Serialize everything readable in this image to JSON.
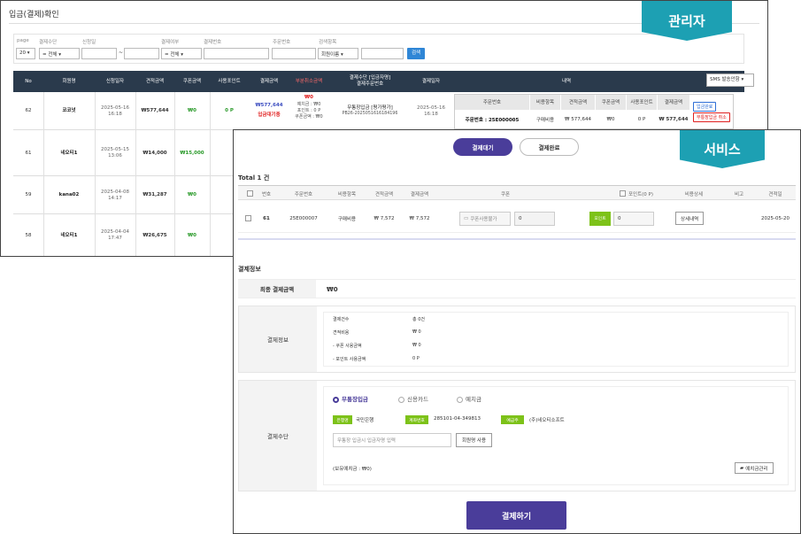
{
  "admin": {
    "title": "입금(결제)확인",
    "filters": [
      {
        "label": "page",
        "value": "20 ▾"
      },
      {
        "label": "결제수단",
        "value": "= 전체 ▾"
      },
      {
        "label": "신청일",
        "value": ""
      },
      {
        "label": "",
        "value": "~"
      },
      {
        "label": "",
        "value": ""
      },
      {
        "label": "결제여부",
        "value": "= 전체 ▾"
      },
      {
        "label": "결제번호",
        "value": ""
      },
      {
        "label": "주문번호",
        "value": ""
      },
      {
        "label": "검색항목",
        "value": "회원이름 ▾"
      },
      {
        "label": "",
        "value": ""
      }
    ],
    "search_label": "검색",
    "columns": [
      "No",
      "회원명",
      "신청일자",
      "견적금액",
      "쿠폰금액",
      "사용포인트",
      "결제금액",
      "부분취소금액",
      "결제수단 [입금자명]\n결제주문번호",
      "결제일자",
      "내역"
    ],
    "sms_label": "SMS 발송안함 ▾",
    "rows": [
      {
        "no": "62",
        "name": "코코넛",
        "date": "2025-05-16\n16:18",
        "quote": "₩577,644",
        "coupon": "₩0",
        "point": "0 P",
        "pay": "₩577,644",
        "pay_status": "입금대기중",
        "cancel": "₩0",
        "cancel_detail": "예치금 : ₩0\n포인트 : 0 P\n쿠폰금액 : ₩0",
        "method": "무통장입금 [평가평가]",
        "order": "PB26-2025051616184196",
        "paydate": "2025-05-16\n16:18"
      },
      {
        "no": "61",
        "name": "네오티1",
        "date": "2025-05-15\n13:06",
        "quote": "₩14,000",
        "coupon": "₩15,000"
      },
      {
        "no": "59",
        "name": "kana02",
        "date": "2025-04-08\n14:17",
        "quote": "₩31,287",
        "coupon": "₩0"
      },
      {
        "no": "58",
        "name": "네오티1",
        "date": "2025-04-04\n17:47",
        "quote": "₩26,675",
        "coupon": "₩0"
      }
    ],
    "sub": {
      "headers": [
        "주문번호",
        "비용항목",
        "견적금액",
        "쿠폰금액",
        "사용포인트",
        "결제금액"
      ],
      "order": "주문번호 : 25E000005",
      "item": "구매비용",
      "quote": "₩ 577,644",
      "coupon": "₩0",
      "point": "0 P",
      "pay": "₩ 577,644"
    },
    "badge_confirm": "입금완료",
    "badge_cancel": "무통장입금 취소",
    "tag": "관리자"
  },
  "service": {
    "tag": "서비스",
    "tabs": [
      "결제대기",
      "결제완료"
    ],
    "total": "Total  1 건",
    "columns": [
      "번호",
      "주문번호",
      "비용항목",
      "견적금액",
      "결제금액",
      "쿠폰",
      "포인트(0 P)",
      "비용상세",
      "비고",
      "견적일"
    ],
    "row": {
      "no": "61",
      "order": "25E000007",
      "item": "구매비용",
      "quote": "₩ 7,572",
      "pay": "₩ 7,572",
      "coupon_btn": "쿠폰사용불가",
      "coupon_val": "0",
      "point_btn": "포인트",
      "point_val": "0",
      "detail_btn": "상세내역",
      "date": "2025-05-20"
    },
    "section": "결제정보",
    "final_label": "최종 결제금액",
    "final_value": "₩0",
    "info_label": "결제정보",
    "info_rows": [
      [
        "결제건수",
        "총 0건"
      ],
      [
        "견적비용",
        "₩ 0"
      ],
      [
        "- 쿠폰 사용금액",
        "₩ 0"
      ],
      [
        "- 포인트 사용금액",
        "0 P"
      ]
    ],
    "method_label": "결제수단",
    "methods": [
      "무통장입금",
      "신용카드",
      "예치금"
    ],
    "bank_tags": [
      "은행명",
      "계좌번호",
      "예금주"
    ],
    "bank": "국민은행",
    "account": "285101-04-349813",
    "holder": "(주)네오티소프트",
    "depositor_placeholder": "무통장 입금시 입금자명 입력",
    "use_name_btn": "회원명 사용",
    "deposit_note": "(보유예치금 : ₩0)",
    "deposit_manage": "예치금관리",
    "pay_button": "결제하기"
  },
  "colors": {
    "header": "#2a3a4c",
    "accent": "#4a3d9a",
    "tag": "#1da0b3",
    "green": "#7dc219"
  }
}
